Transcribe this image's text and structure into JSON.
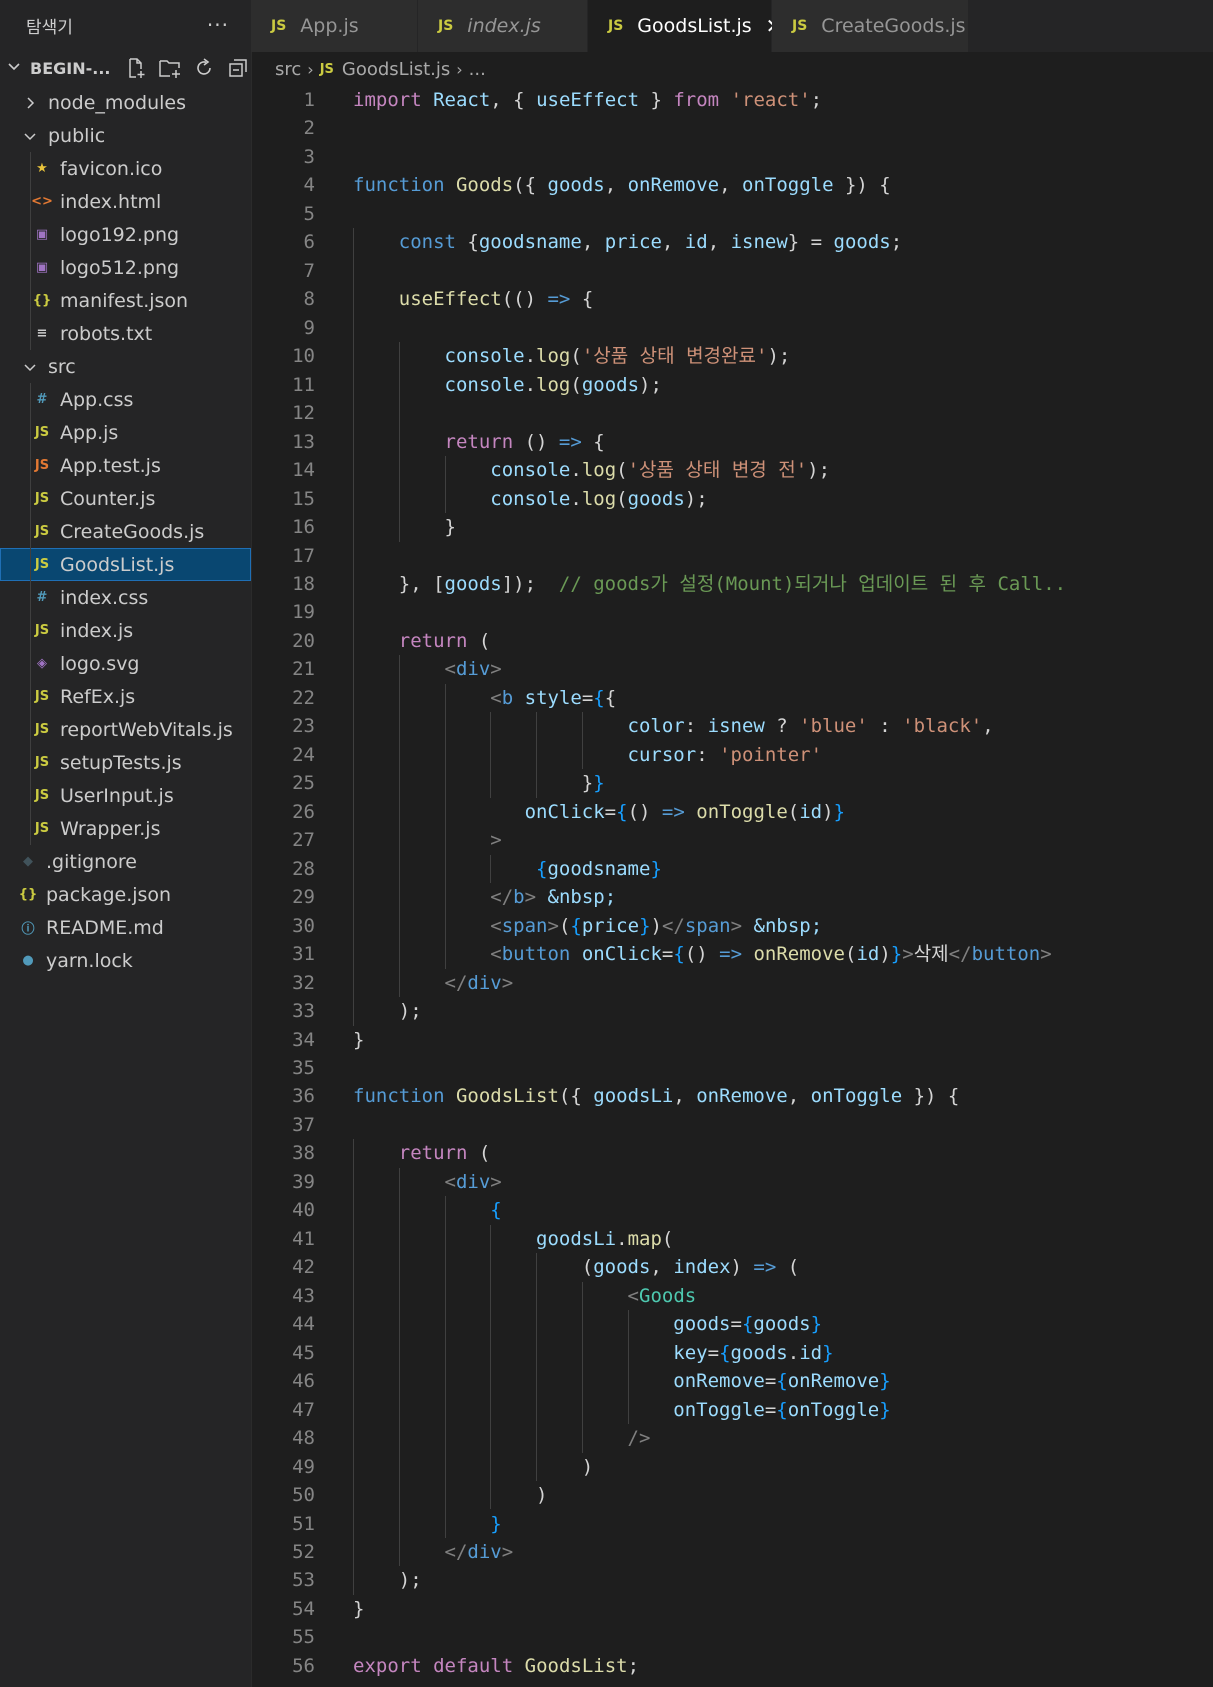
{
  "sidebar": {
    "title": "탐색기",
    "more": "···",
    "root_label": "BEGIN-...",
    "items": [
      {
        "label": "node_modules",
        "type": "folder",
        "collapsed": true,
        "level": 0
      },
      {
        "label": "public",
        "type": "folder",
        "collapsed": false,
        "level": 0
      },
      {
        "label": "favicon.ico",
        "type": "file",
        "icon": "star-icon",
        "level": 1
      },
      {
        "label": "index.html",
        "type": "file",
        "icon": "html-icon",
        "level": 1
      },
      {
        "label": "logo192.png",
        "type": "file",
        "icon": "image-icon",
        "level": 1
      },
      {
        "label": "logo512.png",
        "type": "file",
        "icon": "image-icon",
        "level": 1
      },
      {
        "label": "manifest.json",
        "type": "file",
        "icon": "json-icon",
        "level": 1
      },
      {
        "label": "robots.txt",
        "type": "file",
        "icon": "text-icon",
        "level": 1
      },
      {
        "label": "src",
        "type": "folder",
        "collapsed": false,
        "level": 0
      },
      {
        "label": "App.css",
        "type": "file",
        "icon": "css-icon",
        "level": 1
      },
      {
        "label": "App.js",
        "type": "file",
        "icon": "js-icon",
        "level": 1
      },
      {
        "label": "App.test.js",
        "type": "file",
        "icon": "js-test-icon",
        "level": 1
      },
      {
        "label": "Counter.js",
        "type": "file",
        "icon": "js-icon",
        "level": 1
      },
      {
        "label": "CreateGoods.js",
        "type": "file",
        "icon": "js-icon",
        "level": 1
      },
      {
        "label": "GoodsList.js",
        "type": "file",
        "icon": "js-icon",
        "level": 1,
        "selected": true
      },
      {
        "label": "index.css",
        "type": "file",
        "icon": "css-icon",
        "level": 1
      },
      {
        "label": "index.js",
        "type": "file",
        "icon": "js-icon",
        "level": 1
      },
      {
        "label": "logo.svg",
        "type": "file",
        "icon": "svg-icon",
        "level": 1
      },
      {
        "label": "RefEx.js",
        "type": "file",
        "icon": "js-icon",
        "level": 1
      },
      {
        "label": "reportWebVitals.js",
        "type": "file",
        "icon": "js-icon",
        "level": 1
      },
      {
        "label": "setupTests.js",
        "type": "file",
        "icon": "js-icon",
        "level": 1
      },
      {
        "label": "UserInput.js",
        "type": "file",
        "icon": "js-icon",
        "level": 1
      },
      {
        "label": "Wrapper.js",
        "type": "file",
        "icon": "js-icon",
        "level": 1
      },
      {
        "label": ".gitignore",
        "type": "file",
        "icon": "git-icon",
        "level": 0
      },
      {
        "label": "package.json",
        "type": "file",
        "icon": "json-icon",
        "level": 0
      },
      {
        "label": "README.md",
        "type": "file",
        "icon": "info-icon",
        "level": 0
      },
      {
        "label": "yarn.lock",
        "type": "file",
        "icon": "yarn-icon",
        "level": 0
      }
    ]
  },
  "tabs": [
    {
      "label": "App.js",
      "active": false,
      "italic": false,
      "badge": "JS"
    },
    {
      "label": "index.js",
      "active": false,
      "italic": true,
      "badge": "JS"
    },
    {
      "label": "GoodsList.js",
      "active": true,
      "italic": false,
      "badge": "JS",
      "close": "✕"
    },
    {
      "label": "CreateGoods.js",
      "active": false,
      "italic": false,
      "badge": "JS"
    }
  ],
  "breadcrumb": {
    "folder": "src",
    "badge": "JS",
    "file": "GoodsList.js",
    "more": "..."
  },
  "editor": {
    "lines": [
      [
        [
          "k",
          "import"
        ],
        [
          "p",
          " "
        ],
        [
          "v",
          "React"
        ],
        [
          "p",
          ", { "
        ],
        [
          "v",
          "useEffect"
        ],
        [
          "p",
          " } "
        ],
        [
          "k",
          "from"
        ],
        [
          "p",
          " "
        ],
        [
          "s",
          "'react'"
        ],
        [
          "p",
          ";"
        ]
      ],
      [],
      [],
      [
        [
          "st",
          "function"
        ],
        [
          "p",
          " "
        ],
        [
          "f",
          "Goods"
        ],
        [
          "p",
          "({ "
        ],
        [
          "v",
          "goods"
        ],
        [
          "p",
          ", "
        ],
        [
          "v",
          "onRemove"
        ],
        [
          "p",
          ", "
        ],
        [
          "v",
          "onToggle"
        ],
        [
          "p",
          " }) {"
        ]
      ],
      [],
      [
        [
          "p",
          "    "
        ],
        [
          "st",
          "const"
        ],
        [
          "p",
          " {"
        ],
        [
          "v",
          "goodsname"
        ],
        [
          "p",
          ", "
        ],
        [
          "v",
          "price"
        ],
        [
          "p",
          ", "
        ],
        [
          "v",
          "id"
        ],
        [
          "p",
          ", "
        ],
        [
          "v",
          "isnew"
        ],
        [
          "p",
          "} = "
        ],
        [
          "v",
          "goods"
        ],
        [
          "p",
          ";"
        ]
      ],
      [],
      [
        [
          "p",
          "    "
        ],
        [
          "f",
          "useEffect"
        ],
        [
          "p",
          "(() "
        ],
        [
          "st",
          "=>"
        ],
        [
          "p",
          " {"
        ]
      ],
      [],
      [
        [
          "p",
          "        "
        ],
        [
          "v",
          "console"
        ],
        [
          "p",
          "."
        ],
        [
          "f",
          "log"
        ],
        [
          "p",
          "("
        ],
        [
          "s",
          "'상품 상태 변경완료'"
        ],
        [
          "p",
          ");"
        ]
      ],
      [
        [
          "p",
          "        "
        ],
        [
          "v",
          "console"
        ],
        [
          "p",
          "."
        ],
        [
          "f",
          "log"
        ],
        [
          "p",
          "("
        ],
        [
          "v",
          "goods"
        ],
        [
          "p",
          ");"
        ]
      ],
      [],
      [
        [
          "p",
          "        "
        ],
        [
          "k",
          "return"
        ],
        [
          "p",
          " () "
        ],
        [
          "st",
          "=>"
        ],
        [
          "p",
          " {"
        ]
      ],
      [
        [
          "p",
          "            "
        ],
        [
          "v",
          "console"
        ],
        [
          "p",
          "."
        ],
        [
          "f",
          "log"
        ],
        [
          "p",
          "("
        ],
        [
          "s",
          "'상품 상태 변경 전'"
        ],
        [
          "p",
          ");"
        ]
      ],
      [
        [
          "p",
          "            "
        ],
        [
          "v",
          "console"
        ],
        [
          "p",
          "."
        ],
        [
          "f",
          "log"
        ],
        [
          "p",
          "("
        ],
        [
          "v",
          "goods"
        ],
        [
          "p",
          ");"
        ]
      ],
      [
        [
          "p",
          "        }"
        ]
      ],
      [],
      [
        [
          "p",
          "    }, ["
        ],
        [
          "v",
          "goods"
        ],
        [
          "p",
          "]);  "
        ],
        [
          "c",
          "// goods가 설정(Mount)되거나 업데이트 된 후 Call.."
        ]
      ],
      [],
      [
        [
          "p",
          "    "
        ],
        [
          "k",
          "return"
        ],
        [
          "p",
          " ("
        ]
      ],
      [
        [
          "p",
          "        "
        ],
        [
          "pt",
          "<"
        ],
        [
          "tg",
          "div"
        ],
        [
          "pt",
          ">"
        ]
      ],
      [
        [
          "p",
          "            "
        ],
        [
          "pt",
          "<"
        ],
        [
          "tg",
          "b"
        ],
        [
          "p",
          " "
        ],
        [
          "v",
          "style"
        ],
        [
          "p",
          "="
        ],
        [
          "bk",
          "{"
        ],
        [
          "p",
          "{"
        ]
      ],
      [
        [
          "p",
          "                        "
        ],
        [
          "v",
          "color"
        ],
        [
          "p",
          ": "
        ],
        [
          "v",
          "isnew"
        ],
        [
          "p",
          " ? "
        ],
        [
          "s",
          "'blue'"
        ],
        [
          "p",
          " : "
        ],
        [
          "s",
          "'black'"
        ],
        [
          "p",
          ","
        ]
      ],
      [
        [
          "p",
          "                        "
        ],
        [
          "v",
          "cursor"
        ],
        [
          "p",
          ": "
        ],
        [
          "s",
          "'pointer'"
        ]
      ],
      [
        [
          "p",
          "                    }"
        ],
        [
          "bk",
          "}"
        ]
      ],
      [
        [
          "p",
          "               "
        ],
        [
          "v",
          "onClick"
        ],
        [
          "p",
          "="
        ],
        [
          "bk",
          "{"
        ],
        [
          "p",
          "() "
        ],
        [
          "st",
          "=>"
        ],
        [
          "p",
          " "
        ],
        [
          "f",
          "onToggle"
        ],
        [
          "p",
          "("
        ],
        [
          "v",
          "id"
        ],
        [
          "p",
          ")"
        ],
        [
          "bk",
          "}"
        ]
      ],
      [
        [
          "p",
          "            "
        ],
        [
          "pt",
          ">"
        ]
      ],
      [
        [
          "p",
          "                "
        ],
        [
          "bk",
          "{"
        ],
        [
          "v",
          "goodsname"
        ],
        [
          "bk",
          "}"
        ]
      ],
      [
        [
          "p",
          "            "
        ],
        [
          "pt",
          "</"
        ],
        [
          "tg",
          "b"
        ],
        [
          "pt",
          ">"
        ],
        [
          "p",
          " "
        ],
        [
          "v",
          "&nbsp;"
        ]
      ],
      [
        [
          "p",
          "            "
        ],
        [
          "pt",
          "<"
        ],
        [
          "tg",
          "span"
        ],
        [
          "pt",
          ">"
        ],
        [
          "p",
          "("
        ],
        [
          "bk",
          "{"
        ],
        [
          "v",
          "price"
        ],
        [
          "bk",
          "}"
        ],
        [
          "p",
          ")"
        ],
        [
          "pt",
          "</"
        ],
        [
          "tg",
          "span"
        ],
        [
          "pt",
          ">"
        ],
        [
          "p",
          " "
        ],
        [
          "v",
          "&nbsp;"
        ]
      ],
      [
        [
          "p",
          "            "
        ],
        [
          "pt",
          "<"
        ],
        [
          "tg",
          "button"
        ],
        [
          "p",
          " "
        ],
        [
          "v",
          "onClick"
        ],
        [
          "p",
          "="
        ],
        [
          "bk",
          "{"
        ],
        [
          "p",
          "() "
        ],
        [
          "st",
          "=>"
        ],
        [
          "p",
          " "
        ],
        [
          "f",
          "onRemove"
        ],
        [
          "p",
          "("
        ],
        [
          "v",
          "id"
        ],
        [
          "p",
          ")"
        ],
        [
          "bk",
          "}"
        ],
        [
          "pt",
          ">"
        ],
        [
          "p",
          "삭제"
        ],
        [
          "pt",
          "</"
        ],
        [
          "tg",
          "button"
        ],
        [
          "pt",
          ">"
        ]
      ],
      [
        [
          "p",
          "        "
        ],
        [
          "pt",
          "</"
        ],
        [
          "tg",
          "div"
        ],
        [
          "pt",
          ">"
        ]
      ],
      [
        [
          "p",
          "    );"
        ]
      ],
      [
        [
          "p",
          "}"
        ]
      ],
      [],
      [
        [
          "st",
          "function"
        ],
        [
          "p",
          " "
        ],
        [
          "f",
          "GoodsList"
        ],
        [
          "p",
          "({ "
        ],
        [
          "v",
          "goodsLi"
        ],
        [
          "p",
          ", "
        ],
        [
          "v",
          "onRemove"
        ],
        [
          "p",
          ", "
        ],
        [
          "v",
          "onToggle"
        ],
        [
          "p",
          " }) {"
        ]
      ],
      [],
      [
        [
          "p",
          "    "
        ],
        [
          "k",
          "return"
        ],
        [
          "p",
          " ("
        ]
      ],
      [
        [
          "p",
          "        "
        ],
        [
          "pt",
          "<"
        ],
        [
          "tg",
          "div"
        ],
        [
          "pt",
          ">"
        ]
      ],
      [
        [
          "p",
          "            "
        ],
        [
          "bk",
          "{"
        ]
      ],
      [
        [
          "p",
          "                "
        ],
        [
          "v",
          "goodsLi"
        ],
        [
          "p",
          "."
        ],
        [
          "f",
          "map"
        ],
        [
          "p",
          "("
        ]
      ],
      [
        [
          "p",
          "                    ("
        ],
        [
          "v",
          "goods"
        ],
        [
          "p",
          ", "
        ],
        [
          "v",
          "index"
        ],
        [
          "p",
          ") "
        ],
        [
          "st",
          "=>"
        ],
        [
          "p",
          " ("
        ]
      ],
      [
        [
          "p",
          "                        "
        ],
        [
          "pt",
          "<"
        ],
        [
          "t",
          "Goods"
        ]
      ],
      [
        [
          "p",
          "                            "
        ],
        [
          "v",
          "goods"
        ],
        [
          "p",
          "="
        ],
        [
          "bk",
          "{"
        ],
        [
          "v",
          "goods"
        ],
        [
          "bk",
          "}"
        ]
      ],
      [
        [
          "p",
          "                            "
        ],
        [
          "v",
          "key"
        ],
        [
          "p",
          "="
        ],
        [
          "bk",
          "{"
        ],
        [
          "v",
          "goods"
        ],
        [
          "p",
          "."
        ],
        [
          "v",
          "id"
        ],
        [
          "bk",
          "}"
        ]
      ],
      [
        [
          "p",
          "                            "
        ],
        [
          "v",
          "onRemove"
        ],
        [
          "p",
          "="
        ],
        [
          "bk",
          "{"
        ],
        [
          "v",
          "onRemove"
        ],
        [
          "bk",
          "}"
        ]
      ],
      [
        [
          "p",
          "                            "
        ],
        [
          "v",
          "onToggle"
        ],
        [
          "p",
          "="
        ],
        [
          "bk",
          "{"
        ],
        [
          "v",
          "onToggle"
        ],
        [
          "bk",
          "}"
        ]
      ],
      [
        [
          "p",
          "                        "
        ],
        [
          "pt",
          "/>"
        ]
      ],
      [
        [
          "p",
          "                    )"
        ]
      ],
      [
        [
          "p",
          "                )"
        ]
      ],
      [
        [
          "p",
          "            "
        ],
        [
          "bk",
          "}"
        ]
      ],
      [
        [
          "p",
          "        "
        ],
        [
          "pt",
          "</"
        ],
        [
          "tg",
          "div"
        ],
        [
          "pt",
          ">"
        ]
      ],
      [
        [
          "p",
          "    );"
        ]
      ],
      [
        [
          "p",
          "}"
        ]
      ],
      [],
      [
        [
          "k",
          "export"
        ],
        [
          "p",
          " "
        ],
        [
          "k",
          "default"
        ],
        [
          "p",
          " "
        ],
        [
          "f",
          "GoodsList"
        ],
        [
          "p",
          ";"
        ]
      ]
    ]
  },
  "colors": {
    "editor_bg": "#1e1e1e",
    "sidebar_bg": "#252526",
    "selection": "#094771",
    "keyword": "#c586c0",
    "storage": "#569cd6",
    "function": "#dcdcaa",
    "variable": "#9cdcfe",
    "string": "#ce9178",
    "comment": "#6a9955",
    "type": "#4ec9b0",
    "js_badge": "#cbcb41"
  }
}
